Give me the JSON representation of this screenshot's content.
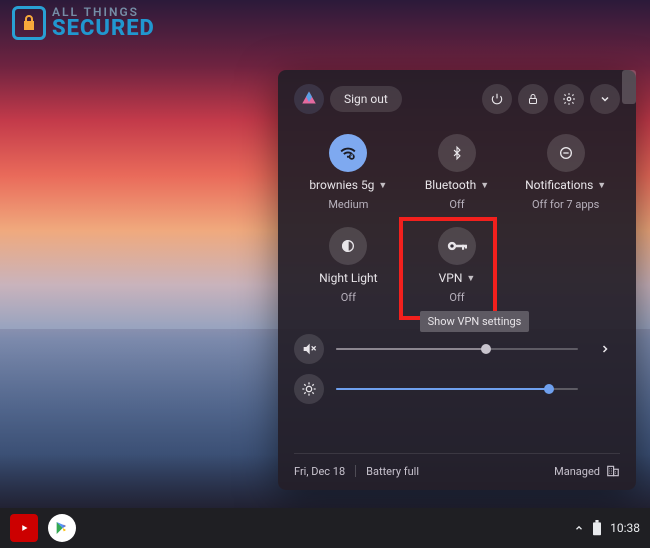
{
  "logo": {
    "line1": "ALL THINGS",
    "line2": "SECURED"
  },
  "panel": {
    "sign_out": "Sign out",
    "tiles": {
      "wifi": {
        "label": "brownies 5g",
        "sub": "Medium"
      },
      "bt": {
        "label": "Bluetooth",
        "sub": "Off"
      },
      "notif": {
        "label": "Notifications",
        "sub": "Off for 7 apps"
      },
      "night": {
        "label": "Night Light",
        "sub": "Off"
      },
      "vpn": {
        "label": "VPN",
        "sub": "Off"
      }
    },
    "tooltip_vpn": "Show VPN settings",
    "volume_pct": 62,
    "brightness_pct": 88,
    "date": "Fri, Dec 18",
    "battery": "Battery full",
    "managed": "Managed"
  },
  "shelf": {
    "clock": "10:38"
  }
}
